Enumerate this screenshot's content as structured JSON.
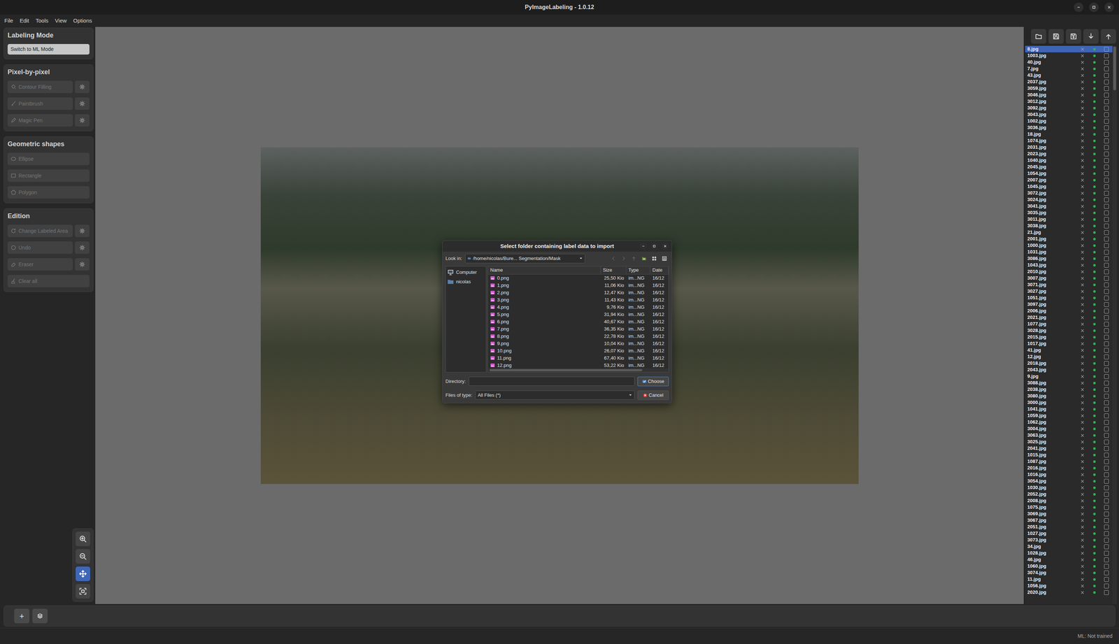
{
  "window": {
    "title": "PyImageLabeling - 1.0.12"
  },
  "menu": [
    "File",
    "Edit",
    "Tools",
    "View",
    "Options"
  ],
  "left_panel": {
    "sections": [
      {
        "title": "Labeling Mode",
        "tools": [
          {
            "label": "Switch to ML Mode",
            "kind": "mode",
            "disabled": false
          }
        ]
      },
      {
        "title": "Pixel-by-pixel",
        "tools": [
          {
            "label": "Contour Filling",
            "kind": "settings",
            "disabled": true
          },
          {
            "label": "Paintbrush",
            "kind": "settings",
            "disabled": true
          },
          {
            "label": "Magic Pen",
            "kind": "settings",
            "disabled": true
          }
        ]
      },
      {
        "title": "Geometric shapes",
        "tools": [
          {
            "label": "Ellipse",
            "kind": "plain",
            "disabled": true
          },
          {
            "label": "Rectangle",
            "kind": "plain",
            "disabled": true
          },
          {
            "label": "Polygon",
            "kind": "plain",
            "disabled": true
          }
        ]
      },
      {
        "title": "Edition",
        "tools": [
          {
            "label": "Change Labeled Area",
            "kind": "settings",
            "disabled": true
          },
          {
            "label": "Undo",
            "kind": "settings",
            "disabled": true
          },
          {
            "label": "Eraser",
            "kind": "settings",
            "disabled": true
          },
          {
            "label": "Clear all",
            "kind": "plain",
            "disabled": true
          }
        ]
      }
    ]
  },
  "zoom_tools": [
    {
      "selected": false
    },
    {
      "selected": false
    },
    {
      "selected": true
    },
    {
      "selected": false
    }
  ],
  "file_list": {
    "items": [
      {
        "name": "8.jpg",
        "selected": true,
        "checked": false
      },
      {
        "name": "1003.jpg",
        "selected": false,
        "checked": false
      },
      {
        "name": "40.jpg",
        "selected": false,
        "checked": false
      },
      {
        "name": "7.jpg",
        "selected": false,
        "checked": false
      },
      {
        "name": "43.jpg",
        "selected": false,
        "checked": false
      },
      {
        "name": "2037.jpg",
        "selected": false,
        "checked": false
      },
      {
        "name": "3059.jpg",
        "selected": false,
        "checked": false
      },
      {
        "name": "3046.jpg",
        "selected": false,
        "checked": false
      },
      {
        "name": "3012.jpg",
        "selected": false,
        "checked": false
      },
      {
        "name": "3092.jpg",
        "selected": false,
        "checked": false
      },
      {
        "name": "3043.jpg",
        "selected": false,
        "checked": false
      },
      {
        "name": "1002.jpg",
        "selected": false,
        "checked": false
      },
      {
        "name": "3036.jpg",
        "selected": false,
        "checked": false
      },
      {
        "name": "18.jpg",
        "selected": false,
        "checked": false
      },
      {
        "name": "1074.jpg",
        "selected": false,
        "checked": false
      },
      {
        "name": "2031.jpg",
        "selected": false,
        "checked": false
      },
      {
        "name": "2023.jpg",
        "selected": false,
        "checked": false
      },
      {
        "name": "1040.jpg",
        "selected": false,
        "checked": false
      },
      {
        "name": "2045.jpg",
        "selected": false,
        "checked": false
      },
      {
        "name": "1054.jpg",
        "selected": false,
        "checked": false
      },
      {
        "name": "2007.jpg",
        "selected": false,
        "checked": false
      },
      {
        "name": "1045.jpg",
        "selected": false,
        "checked": false
      },
      {
        "name": "3072.jpg",
        "selected": false,
        "checked": false
      },
      {
        "name": "3024.jpg",
        "selected": false,
        "checked": false
      },
      {
        "name": "3041.jpg",
        "selected": false,
        "checked": false
      },
      {
        "name": "3035.jpg",
        "selected": false,
        "checked": false
      },
      {
        "name": "3011.jpg",
        "selected": false,
        "checked": false
      },
      {
        "name": "3038.jpg",
        "selected": false,
        "checked": false
      },
      {
        "name": "21.jpg",
        "selected": false,
        "checked": false
      },
      {
        "name": "2001.jpg",
        "selected": false,
        "checked": false
      },
      {
        "name": "1000.jpg",
        "selected": false,
        "checked": false
      },
      {
        "name": "1031.jpg",
        "selected": false,
        "checked": false
      },
      {
        "name": "3086.jpg",
        "selected": false,
        "checked": false
      },
      {
        "name": "1043.jpg",
        "selected": false,
        "checked": false
      },
      {
        "name": "2010.jpg",
        "selected": false,
        "checked": false
      },
      {
        "name": "3007.jpg",
        "selected": false,
        "checked": false
      },
      {
        "name": "3071.jpg",
        "selected": false,
        "checked": false
      },
      {
        "name": "3027.jpg",
        "selected": false,
        "checked": false
      },
      {
        "name": "1051.jpg",
        "selected": false,
        "checked": false
      },
      {
        "name": "3097.jpg",
        "selected": false,
        "checked": false
      },
      {
        "name": "2006.jpg",
        "selected": false,
        "checked": false
      },
      {
        "name": "2021.jpg",
        "selected": false,
        "checked": false
      },
      {
        "name": "1077.jpg",
        "selected": false,
        "checked": false
      },
      {
        "name": "3028.jpg",
        "selected": false,
        "checked": false
      },
      {
        "name": "2015.jpg",
        "selected": false,
        "checked": false
      },
      {
        "name": "1017.jpg",
        "selected": false,
        "checked": false
      },
      {
        "name": "41.jpg",
        "selected": false,
        "checked": false
      },
      {
        "name": "12.jpg",
        "selected": false,
        "checked": false
      },
      {
        "name": "2018.jpg",
        "selected": false,
        "checked": false
      },
      {
        "name": "2043.jpg",
        "selected": false,
        "checked": false
      },
      {
        "name": "9.jpg",
        "selected": false,
        "checked": false
      },
      {
        "name": "3088.jpg",
        "selected": false,
        "checked": false
      },
      {
        "name": "2038.jpg",
        "selected": false,
        "checked": false
      },
      {
        "name": "3080.jpg",
        "selected": false,
        "checked": false
      },
      {
        "name": "3000.jpg",
        "selected": false,
        "checked": false
      },
      {
        "name": "1041.jpg",
        "selected": false,
        "checked": false
      },
      {
        "name": "1059.jpg",
        "selected": false,
        "checked": false
      },
      {
        "name": "1062.jpg",
        "selected": false,
        "checked": false
      },
      {
        "name": "3004.jpg",
        "selected": false,
        "checked": false
      },
      {
        "name": "3063.jpg",
        "selected": false,
        "checked": false
      },
      {
        "name": "3025.jpg",
        "selected": false,
        "checked": false
      },
      {
        "name": "2041.jpg",
        "selected": false,
        "checked": false
      },
      {
        "name": "1015.jpg",
        "selected": false,
        "checked": false
      },
      {
        "name": "1087.jpg",
        "selected": false,
        "checked": false
      },
      {
        "name": "2016.jpg",
        "selected": false,
        "checked": false
      },
      {
        "name": "1016.jpg",
        "selected": false,
        "checked": false
      },
      {
        "name": "3054.jpg",
        "selected": false,
        "checked": false
      },
      {
        "name": "1030.jpg",
        "selected": false,
        "checked": false
      },
      {
        "name": "2052.jpg",
        "selected": false,
        "checked": false
      },
      {
        "name": "2008.jpg",
        "selected": false,
        "checked": false
      },
      {
        "name": "1075.jpg",
        "selected": false,
        "checked": false
      },
      {
        "name": "3069.jpg",
        "selected": false,
        "checked": false
      },
      {
        "name": "3067.jpg",
        "selected": false,
        "checked": false
      },
      {
        "name": "2051.jpg",
        "selected": false,
        "checked": false
      },
      {
        "name": "1027.jpg",
        "selected": false,
        "checked": false
      },
      {
        "name": "3073.jpg",
        "selected": false,
        "checked": false
      },
      {
        "name": "34.jpg",
        "selected": false,
        "checked": false
      },
      {
        "name": "1028.jpg",
        "selected": false,
        "checked": false
      },
      {
        "name": "46.jpg",
        "selected": false,
        "checked": false
      },
      {
        "name": "1060.jpg",
        "selected": false,
        "checked": false
      },
      {
        "name": "3074.jpg",
        "selected": false,
        "checked": false
      },
      {
        "name": "11.jpg",
        "selected": false,
        "checked": false
      },
      {
        "name": "1056.jpg",
        "selected": false,
        "checked": false
      },
      {
        "name": "2020.jpg",
        "selected": false,
        "checked": false
      }
    ]
  },
  "bottom_bar": {
    "add_button": "+"
  },
  "status_bar": {
    "text": "ML: Not trained"
  },
  "dialog": {
    "title": "Select folder containing label data to import",
    "look_in_label": "Look in:",
    "path": "/home/nicolas/Bure... Segmentation/Mask",
    "nav_buttons": [
      {
        "disabled": true
      },
      {
        "disabled": true
      },
      {
        "disabled": true
      },
      {
        "disabled": false
      },
      {
        "disabled": false
      },
      {
        "disabled": false
      }
    ],
    "places": [
      "Computer",
      "nicolas"
    ],
    "columns": [
      "Name",
      "Size",
      "Type",
      "Date"
    ],
    "rows": [
      {
        "name": "0.png",
        "size": "25,50 Kio",
        "type": "im...NG",
        "date": "16/12"
      },
      {
        "name": "1.png",
        "size": "11,06 Kio",
        "type": "im...NG",
        "date": "16/12"
      },
      {
        "name": "2.png",
        "size": "12,47 Kio",
        "type": "im...NG",
        "date": "16/12"
      },
      {
        "name": "3.png",
        "size": "11,43 Kio",
        "type": "im...NG",
        "date": "16/12"
      },
      {
        "name": "4.png",
        "size": "9,76 Kio",
        "type": "im...NG",
        "date": "16/12"
      },
      {
        "name": "5.png",
        "size": "31,94 Kio",
        "type": "im...NG",
        "date": "16/12"
      },
      {
        "name": "6.png",
        "size": "40,67 Kio",
        "type": "im...NG",
        "date": "16/12"
      },
      {
        "name": "7.png",
        "size": "36,35 Kio",
        "type": "im...NG",
        "date": "16/12"
      },
      {
        "name": "8.png",
        "size": "22,78 Kio",
        "type": "im...NG",
        "date": "16/12"
      },
      {
        "name": "9.png",
        "size": "10,04 Kio",
        "type": "im...NG",
        "date": "16/12"
      },
      {
        "name": "10.png",
        "size": "26,07 Kio",
        "type": "im...NG",
        "date": "16/12"
      },
      {
        "name": "11.png",
        "size": "67,40 Kio",
        "type": "im...NG",
        "date": "16/12"
      },
      {
        "name": "12.png",
        "size": "53,22 Kio",
        "type": "im...NG",
        "date": "16/12"
      }
    ],
    "directory_label": "Directory:",
    "directory_value": "",
    "choose_button": "Choose",
    "type_label": "Files of type:",
    "type_value": "All Files (*)",
    "cancel_button": "Cancel"
  }
}
